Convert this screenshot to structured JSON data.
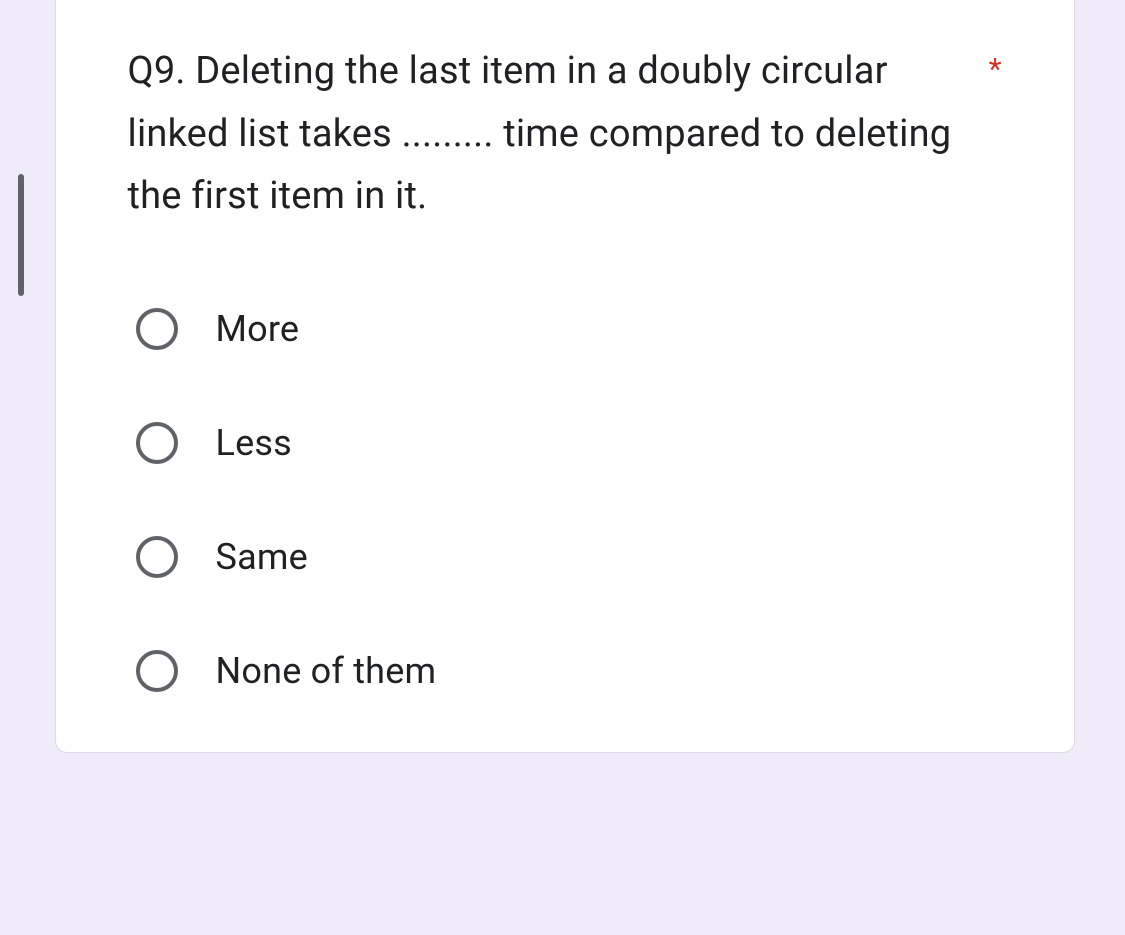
{
  "question": {
    "text": "Q9. Deleting the last item in a doubly circular linked list takes ......... time compared to deleting the first item in it.",
    "required_marker": "*",
    "options": [
      {
        "label": "More"
      },
      {
        "label": "Less"
      },
      {
        "label": "Same"
      },
      {
        "label": "None of them"
      }
    ]
  }
}
